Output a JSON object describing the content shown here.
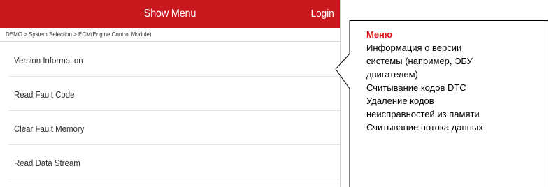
{
  "screen": {
    "header": {
      "title": "Show Menu",
      "login_label": "Login"
    },
    "breadcrumb": "DEMO > System Selection > ECM(Engine Control Module)",
    "menu_items": [
      {
        "label": "Version Information"
      },
      {
        "label": "Read Fault Code"
      },
      {
        "label": "Clear Fault Memory"
      },
      {
        "label": "Read Data Stream"
      }
    ]
  },
  "callout": {
    "title": "Меню",
    "lines": [
      "Информация о версии",
      "системы (например, ЭБУ",
      "двигателем)",
      "Считывание кодов DTC",
      "Удаление кодов",
      "неисправностей из памяти",
      "Считывание потока данных"
    ]
  },
  "colors": {
    "header_bg": "#c8171d",
    "callout_title": "#e0141b"
  }
}
